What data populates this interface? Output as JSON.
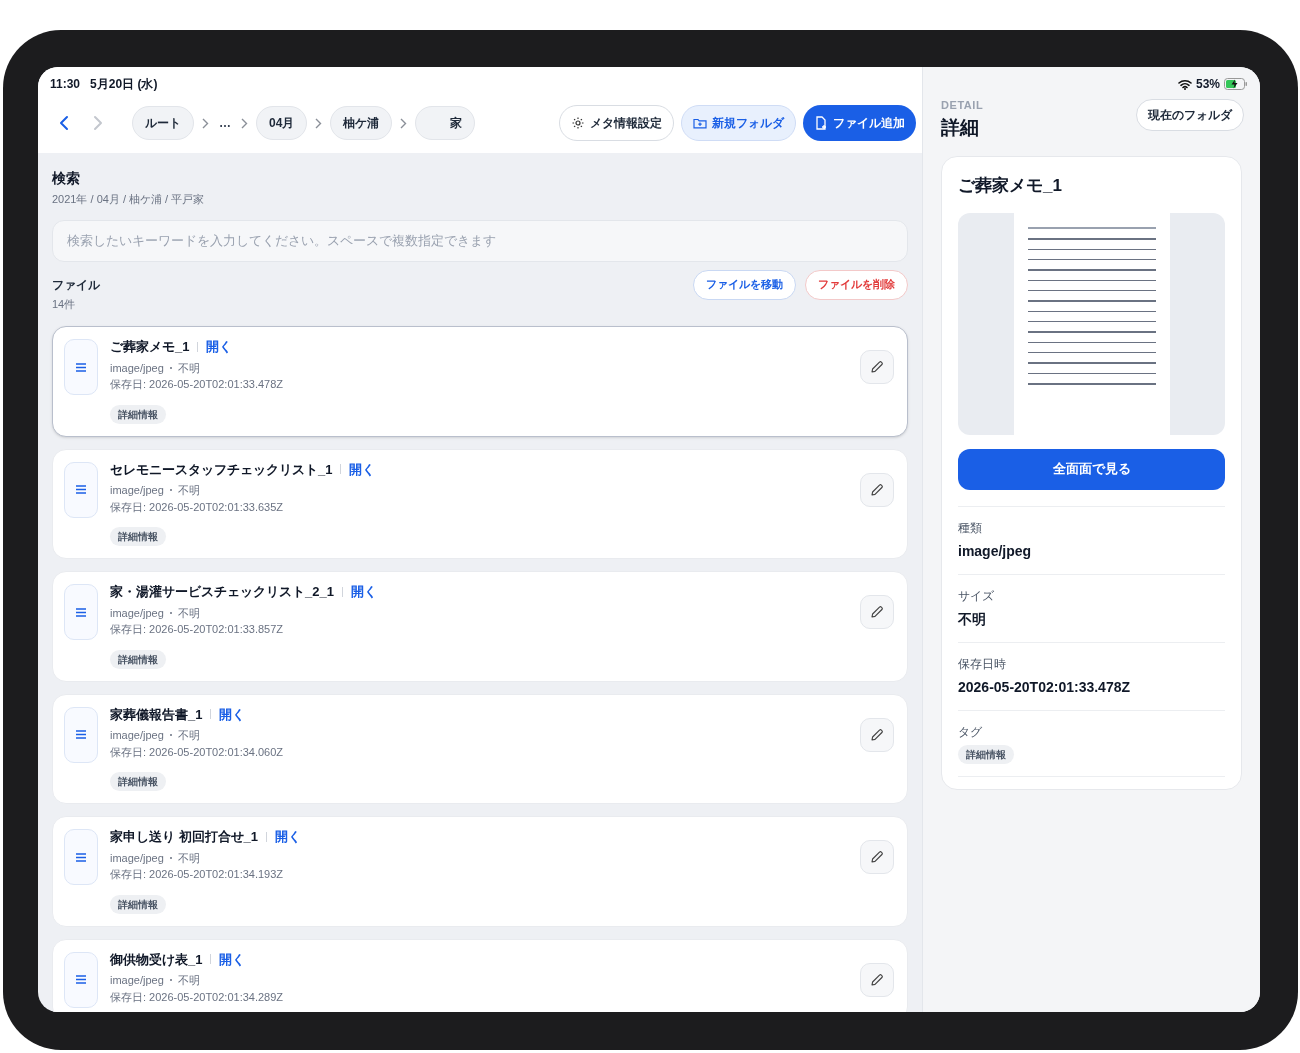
{
  "status_bar": {
    "time": "11:30",
    "date": "5月20日 (水)",
    "battery": "53%"
  },
  "nav": {
    "back": {
      "disabled": false
    },
    "forward": {
      "disabled": true
    }
  },
  "breadcrumbs": [
    {
      "label": "ルート",
      "kind": "crumb"
    },
    {
      "label": "…",
      "kind": "ellipsis"
    },
    {
      "label": "04月",
      "kind": "crumb"
    },
    {
      "label": "柚ケ浦",
      "kind": "crumb"
    },
    {
      "label": "家",
      "kind": "crumb"
    }
  ],
  "toolbar": [
    {
      "label": "メタ情報設定",
      "kind": "outline"
    },
    {
      "label": "新規フォルダ",
      "kind": "tinted"
    },
    {
      "label": "ファイル追加",
      "kind": "primary"
    }
  ],
  "search": {
    "title": "検索",
    "path": "2021年 / 04月 / 柚ケ浦 / 平戸家",
    "placeholder": "検索したいキーワードを入力してください。スペースで複数指定できます"
  },
  "files_section": {
    "title": "ファイル",
    "count": "14件",
    "actions": [
      {
        "label": "ファイルを移動",
        "kind": "primary"
      },
      {
        "label": "ファイルを削除",
        "kind": "danger"
      }
    ]
  },
  "files": [
    {
      "name": "ご葬家メモ_1",
      "open": "開く",
      "type": "image/jpeg",
      "size": "不明",
      "saved": "保存日: 2026-05-20T02:01:33.478Z",
      "tag": "詳細情報",
      "selected": true
    },
    {
      "name": "セレモニースタッフチェックリスト_1",
      "open": "開く",
      "type": "image/jpeg",
      "size": "不明",
      "saved": "保存日: 2026-05-20T02:01:33.635Z",
      "tag": "詳細情報",
      "selected": false
    },
    {
      "name": "家・湯灌サービスチェックリスト_2_1",
      "open": "開く",
      "type": "image/jpeg",
      "size": "不明",
      "saved": "保存日: 2026-05-20T02:01:33.857Z",
      "tag": "詳細情報",
      "selected": false
    },
    {
      "name": "家葬儀報告書_1",
      "open": "開く",
      "type": "image/jpeg",
      "size": "不明",
      "saved": "保存日: 2026-05-20T02:01:34.060Z",
      "tag": "詳細情報",
      "selected": false
    },
    {
      "name": "家申し送り 初回打合せ_1",
      "open": "開く",
      "type": "image/jpeg",
      "size": "不明",
      "saved": "保存日: 2026-05-20T02:01:34.193Z",
      "tag": "詳細情報",
      "selected": false
    },
    {
      "name": "御供物受け表_1",
      "open": "開く",
      "type": "image/jpeg",
      "size": "不明",
      "saved": "保存日: 2026-05-20T02:01:34.289Z",
      "selected": false
    }
  ],
  "detail": {
    "eyebrow": "DETAIL",
    "title": "詳細",
    "folder_button": "現在のフォルダ",
    "card_title": "ご葬家メモ_1",
    "view_button": "全面面で見る",
    "fields": [
      {
        "label": "種類",
        "value": "image/jpeg",
        "kind": "text"
      },
      {
        "label": "サイズ",
        "value": "不明",
        "kind": "text"
      },
      {
        "label": "保存日時",
        "value": "2026-05-20T02:01:33.478Z",
        "kind": "text"
      },
      {
        "label": "タグ",
        "value": "詳細情報",
        "kind": "tag"
      }
    ]
  }
}
